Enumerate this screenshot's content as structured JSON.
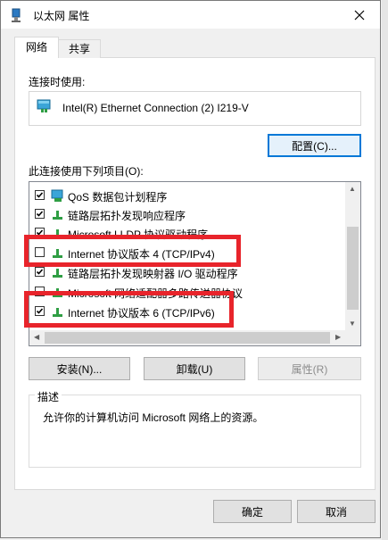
{
  "window": {
    "title": "以太网 属性"
  },
  "tabs": [
    {
      "label": "网络"
    },
    {
      "label": "共享"
    }
  ],
  "connect_using": {
    "label": "连接时使用:",
    "adapter": "Intel(R) Ethernet Connection (2) I219-V",
    "configure_button": "配置(C)..."
  },
  "items": {
    "label": "此连接使用下列项目(O):",
    "list": [
      {
        "label": "QoS 数据包计划程序",
        "checked": true
      },
      {
        "label": "链路层拓扑发现响应程序",
        "checked": true
      },
      {
        "label": "Microsoft LLDP 协议驱动程序",
        "checked": true
      },
      {
        "label": "Internet 协议版本 4 (TCP/IPv4)",
        "checked": false
      },
      {
        "label": "链路层拓扑发现映射器 I/O 驱动程序",
        "checked": true
      },
      {
        "label": "Microsoft 网络适配器多路传送器协议",
        "checked": false
      },
      {
        "label": "Internet 协议版本 6 (TCP/IPv6)",
        "checked": true
      }
    ]
  },
  "buttons": {
    "install": "安装(N)...",
    "uninstall": "卸载(U)",
    "properties": "属性(R)",
    "ok": "确定",
    "cancel": "取消"
  },
  "description": {
    "legend": "描述",
    "text": "允许你的计算机访问 Microsoft 网络上的资源。"
  },
  "colors": {
    "highlight": "#e8242b",
    "focus": "#0078d7"
  }
}
